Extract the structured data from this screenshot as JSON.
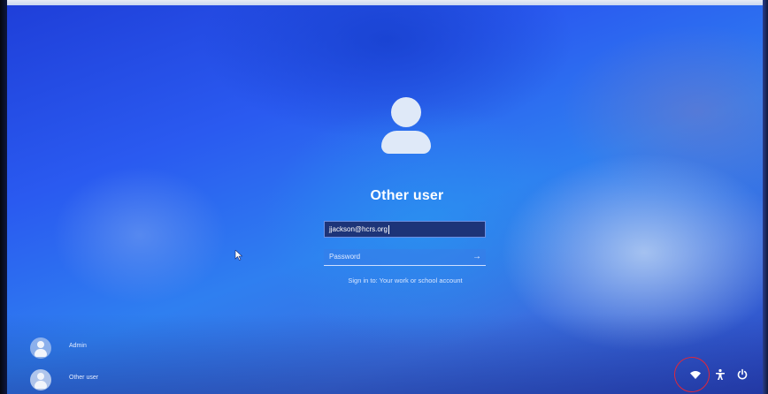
{
  "login": {
    "user_display_name": "Other user",
    "username_value": "jjackson@hcrs.org",
    "password_placeholder": "Password",
    "submit_icon": "arrow-right-icon",
    "sign_in_to": "Sign in to: Your work or school account"
  },
  "users": [
    {
      "name": "Admin",
      "icon": "user-avatar-icon"
    },
    {
      "name": "Other user",
      "icon": "user-avatar-icon"
    }
  ],
  "system_tray": {
    "network_icon": "wifi-icon",
    "accessibility_icon": "accessibility-icon",
    "power_icon": "power-icon"
  },
  "colors": {
    "annotation_circle": "#e0283a",
    "field_active_bg": "#1d3478",
    "text": "#ffffff"
  }
}
